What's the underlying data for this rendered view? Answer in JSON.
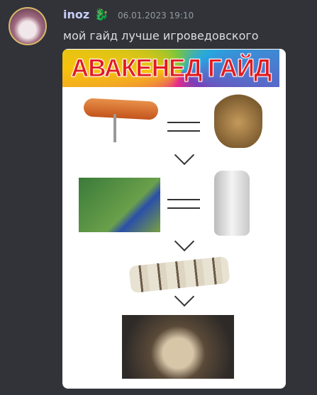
{
  "message": {
    "author": "inoz",
    "badge_icon": "winged-creature-icon",
    "timestamp": "06.01.2023 19:10",
    "text": "мой гайд лучше игроведовского",
    "image": {
      "banner_text": "АВАКЕНЕД ГАЙД"
    }
  }
}
